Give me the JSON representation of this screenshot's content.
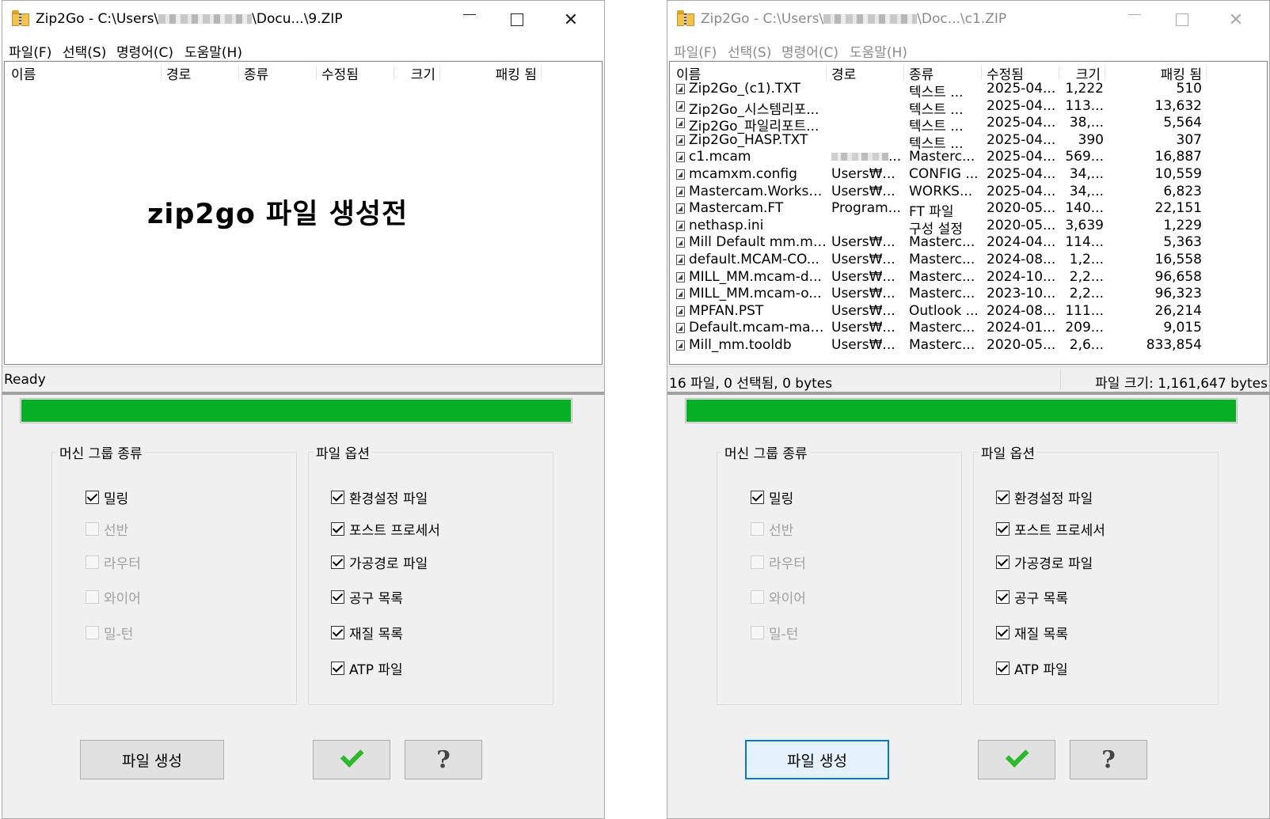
{
  "left": {
    "title_prefix": "Zip2Go - C:\\Users\\",
    "title_suffix": "\\Docu...\\9.ZIP",
    "menu": [
      "파일(F)",
      "선택(S)",
      "명령어(C)",
      "도움말(H)"
    ],
    "columns": [
      "이름",
      "경로",
      "종류",
      "수정됨",
      "크기",
      "패킹 됨"
    ],
    "empty_note": "zip2go 파일 생성전",
    "status_left": "Ready",
    "progress": 1.0,
    "machine_group": {
      "label": "머신 그룹 종류",
      "items": [
        {
          "label": "밀링",
          "checked": true,
          "enabled": true
        },
        {
          "label": "선반",
          "checked": false,
          "enabled": false
        },
        {
          "label": "라우터",
          "checked": false,
          "enabled": false
        },
        {
          "label": "와이어",
          "checked": false,
          "enabled": false
        },
        {
          "label": "밀-턴",
          "checked": false,
          "enabled": false
        }
      ]
    },
    "file_group": {
      "label": "파일 옵션",
      "items": [
        {
          "label": "환경설정 파일",
          "checked": true
        },
        {
          "label": "포스트 프로세서",
          "checked": true
        },
        {
          "label": "가공경로 파일",
          "checked": true
        },
        {
          "label": "공구 목록",
          "checked": true
        },
        {
          "label": "재질 목록",
          "checked": true
        },
        {
          "label": "ATP 파일",
          "checked": true
        }
      ]
    },
    "create_button": "파일 생성",
    "ok_icon": "green-check-icon",
    "help_icon": "question-icon"
  },
  "right": {
    "title_prefix": "Zip2Go - C:\\Users\\",
    "title_suffix": "\\Doc...\\c1.ZIP",
    "menu": [
      "파일(F)",
      "선택(S)",
      "명령어(C)",
      "도움말(H)"
    ],
    "columns": [
      "이름",
      "경로",
      "종류",
      "수정됨",
      "크기",
      "패킹 됨"
    ],
    "rows": [
      {
        "name": "Zip2Go_(c1).TXT",
        "path": "",
        "type": "텍스트 ...",
        "modified": "2025-04...",
        "size": "1,222",
        "packed": "510"
      },
      {
        "name": "Zip2Go_시스템리포...",
        "path": "",
        "type": "텍스트 ...",
        "modified": "2025-04...",
        "size": "113...",
        "packed": "13,632"
      },
      {
        "name": "Zip2Go_파일리포트...",
        "path": "",
        "type": "텍스트 ...",
        "modified": "2025-04...",
        "size": "38,...",
        "packed": "5,564"
      },
      {
        "name": "Zip2Go_HASP.TXT",
        "path": "",
        "type": "텍스트 ...",
        "modified": "2025-04...",
        "size": "390",
        "packed": "307"
      },
      {
        "name": "c1.mcam",
        "path": "",
        "path_blurred": true,
        "type": "Masterc...",
        "modified": "2025-04...",
        "size": "569...",
        "packed": "16,887"
      },
      {
        "name": "mcamxm.config",
        "path": "Users₩...",
        "type": "CONFIG ...",
        "modified": "2025-04...",
        "size": "34,...",
        "packed": "10,559"
      },
      {
        "name": "Mastercam.Worksp...",
        "path": "Users₩...",
        "type": "WORKS...",
        "modified": "2025-04...",
        "size": "34,...",
        "packed": "6,823"
      },
      {
        "name": "Mastercam.FT",
        "path": "Program...",
        "type": "FT 파일",
        "modified": "2020-05...",
        "size": "140...",
        "packed": "22,151"
      },
      {
        "name": "nethasp.ini",
        "path": "",
        "type": "구성 설정",
        "modified": "2020-05...",
        "size": "3,639",
        "packed": "1,229"
      },
      {
        "name": "Mill Default mm.mc...",
        "path": "Users₩...",
        "type": "Masterc...",
        "modified": "2024-04...",
        "size": "114...",
        "packed": "5,363"
      },
      {
        "name": "default.MCAM-CO...",
        "path": "Users₩...",
        "type": "Masterc...",
        "modified": "2024-08...",
        "size": "1,2...",
        "packed": "16,558"
      },
      {
        "name": "MILL_MM.mcam-d...",
        "path": "Users₩...",
        "type": "Masterc...",
        "modified": "2024-10...",
        "size": "2,2...",
        "packed": "96,658"
      },
      {
        "name": "MILL_MM.mcam-o...",
        "path": "Users₩...",
        "type": "Masterc...",
        "modified": "2023-10...",
        "size": "2,2...",
        "packed": "96,323"
      },
      {
        "name": "MPFAN.PST",
        "path": "Users₩...",
        "type": "Outlook ...",
        "modified": "2024-08...",
        "size": "111...",
        "packed": "26,214"
      },
      {
        "name": "Default.mcam-mat...",
        "path": "Users₩...",
        "type": "Masterc...",
        "modified": "2024-01...",
        "size": "209...",
        "packed": "9,015"
      },
      {
        "name": "Mill_mm.tooldb",
        "path": "Users₩...",
        "type": "Masterc...",
        "modified": "2020-05...",
        "size": "2,6...",
        "packed": "833,854"
      }
    ],
    "status_left": "16 파일, 0 선택됨, 0 bytes",
    "status_right": "파일 크기: 1,161,647 bytes",
    "progress": 1.0,
    "machine_group": {
      "label": "머신 그룹 종류",
      "items": [
        {
          "label": "밀링",
          "checked": true,
          "enabled": true
        },
        {
          "label": "선반",
          "checked": false,
          "enabled": false
        },
        {
          "label": "라우터",
          "checked": false,
          "enabled": false
        },
        {
          "label": "와이어",
          "checked": false,
          "enabled": false
        },
        {
          "label": "밀-턴",
          "checked": false,
          "enabled": false
        }
      ]
    },
    "file_group": {
      "label": "파일 옵션",
      "items": [
        {
          "label": "환경설정 파일",
          "checked": true
        },
        {
          "label": "포스트 프로세서",
          "checked": true
        },
        {
          "label": "가공경로 파일",
          "checked": true
        },
        {
          "label": "공구 목록",
          "checked": true
        },
        {
          "label": "재질 목록",
          "checked": true
        },
        {
          "label": "ATP 파일",
          "checked": true
        }
      ]
    },
    "create_button": "파일 생성",
    "ok_icon": "green-check-icon",
    "help_icon": "question-icon"
  },
  "colors": {
    "progress_fill": "#06b025",
    "focus_border": "#0078d7"
  }
}
